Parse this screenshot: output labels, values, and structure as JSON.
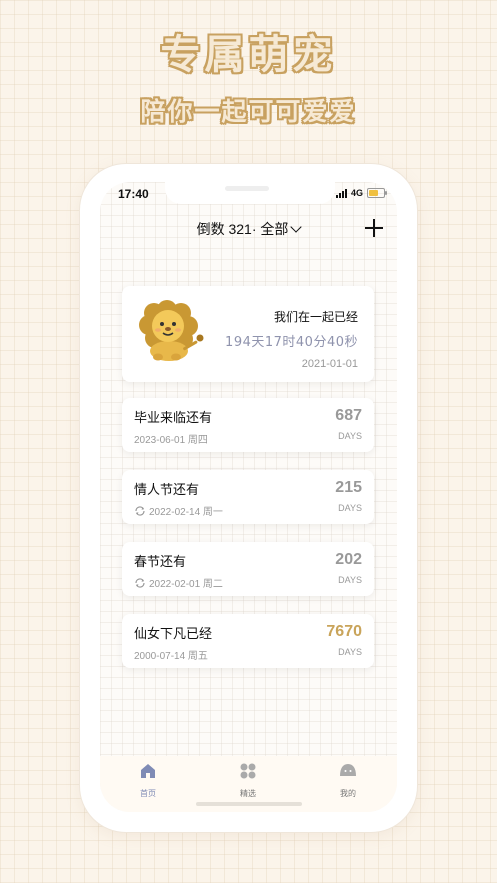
{
  "promo": {
    "title": "专属萌宠",
    "subtitle": "陪你一起可可爱爱"
  },
  "status_bar": {
    "time": "17:40",
    "network": "4G"
  },
  "header": {
    "title": "倒数 321· 全部"
  },
  "hero": {
    "label": "我们在一起已经",
    "counter": "194天17时40分40秒",
    "date": "2021-01-01"
  },
  "events": [
    {
      "title": "毕业来临还有",
      "date": "2023-06-01 周四",
      "count": "687",
      "unit": "DAYS",
      "repeat": false,
      "count_color": "#9b9b9b"
    },
    {
      "title": "情人节还有",
      "date": "2022-02-14 周一",
      "count": "215",
      "unit": "DAYS",
      "repeat": true,
      "count_color": "#9b9b9b"
    },
    {
      "title": "春节还有",
      "date": "2022-02-01 周二",
      "count": "202",
      "unit": "DAYS",
      "repeat": true,
      "count_color": "#9b9b9b"
    },
    {
      "title": "仙女下凡已经",
      "date": "2000-07-14 周五",
      "count": "7670",
      "unit": "DAYS",
      "repeat": false,
      "count_color": "#c9a45a"
    }
  ],
  "tabbar": {
    "items": [
      {
        "label": "首页",
        "icon": "home-icon",
        "active": true
      },
      {
        "label": "精选",
        "icon": "grid-icon",
        "active": false
      },
      {
        "label": "我的",
        "icon": "profile-icon",
        "active": false
      }
    ]
  },
  "colors": {
    "accent": "#7f8bb5",
    "gold": "#c8a160",
    "hero_counter": "#8f93ad"
  }
}
